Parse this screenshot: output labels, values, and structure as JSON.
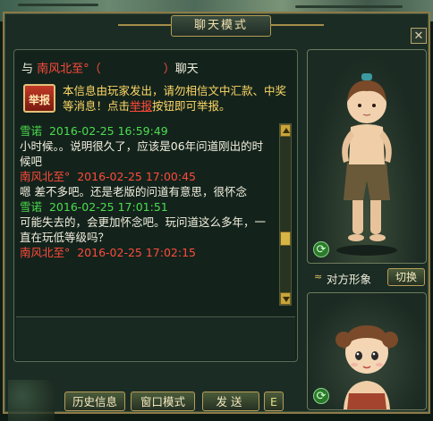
{
  "window": {
    "title": "聊天模式",
    "close_glyph": "✕"
  },
  "chat": {
    "header_prefix": "与",
    "partner_name": "南风北至°",
    "paren_open": "（",
    "paren_close": "）",
    "header_suffix": "聊天",
    "report_icon_label": "举报",
    "notice_part1": "本信息由玩家发出，请勿相信文中汇款、中奖等消息！点击",
    "notice_link": "举报",
    "notice_part2": "按钮即可举报。",
    "messages": [
      {
        "sender": "雪诺",
        "time": "2016-02-25 16:59:49",
        "color": "green",
        "text": "小时候。。说明很久了，应该是06年问道刚出的时候吧"
      },
      {
        "sender": "南风北至°",
        "time": "2016-02-25 17:00:45",
        "color": "red",
        "text": "嗯 差不多吧。还是老版的问道有意思，很怀念"
      },
      {
        "sender": "雪诺",
        "time": "2016-02-25 17:01:51",
        "color": "green",
        "text": "可能失去的，会更加怀念吧。玩问道这么多年，一直在玩低等级吗？"
      },
      {
        "sender": "南风北至°",
        "time": "2016-02-25 17:02:15",
        "color": "red",
        "text": ""
      }
    ],
    "input_value": ""
  },
  "buttons": {
    "history": "历史信息",
    "window_mode": "窗口模式",
    "send": "发送",
    "emoji": "E"
  },
  "side": {
    "partner_image_label": "对方形象",
    "switch": "切换",
    "chevron_glyph": "≈",
    "refresh_glyph": "⟳"
  },
  "colors": {
    "green_name": "#4ddc4d",
    "red_name": "#ff4a3a",
    "notice": "#ffd866",
    "frame_gold": "#b79d58"
  }
}
